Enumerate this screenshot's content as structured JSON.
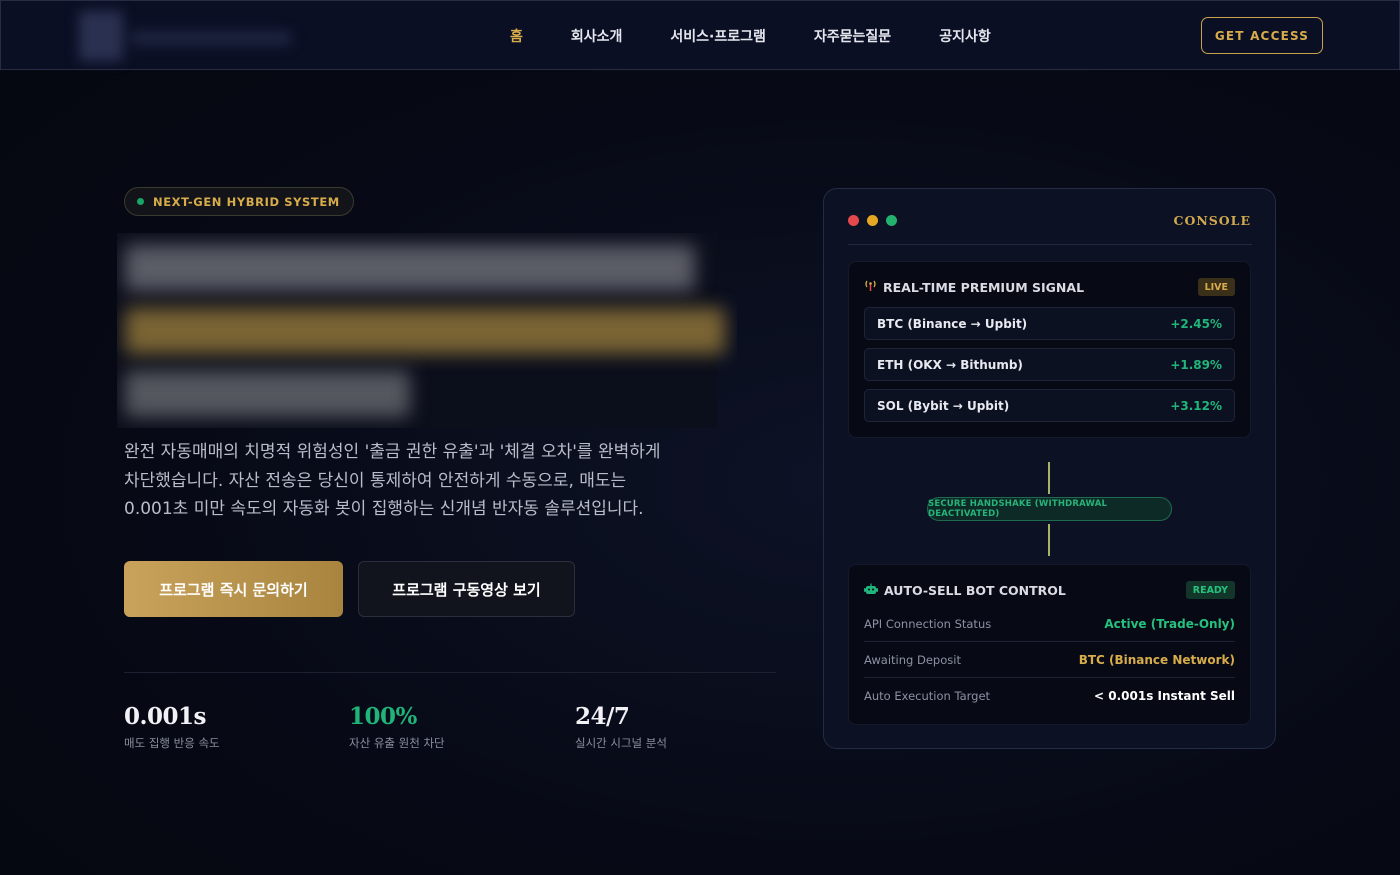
{
  "nav": {
    "items": [
      {
        "label": "홈",
        "active": true
      },
      {
        "label": "회사소개",
        "active": false
      },
      {
        "label": "서비스·프로그램",
        "active": false
      },
      {
        "label": "자주묻는질문",
        "active": false
      },
      {
        "label": "공지사항",
        "active": false
      }
    ],
    "cta_label": "GET ACCESS"
  },
  "hero": {
    "badge": "NEXT-GEN HYBRID SYSTEM",
    "description_lines": [
      "완전 자동매매의 치명적 위험성인 '출금 권한 유출'과 '체결 오차'를 완벽하게",
      "차단했습니다. 자산 전송은 당신이 통제하여 안전하게 수동으로, 매도는",
      "0.001초 미만 속도의 자동화 봇이 집행하는 신개념 반자동 솔루션입니다."
    ],
    "primary_button": "프로그램 즉시 문의하기",
    "secondary_button": "프로그램 구동영상 보기",
    "stats": [
      {
        "value": "0.001s",
        "label": "매도 집행 반응 속도"
      },
      {
        "value": "100%",
        "label": "자산 유출 원천 차단"
      },
      {
        "value": "24/7",
        "label": "실시간 시그널 분석"
      }
    ]
  },
  "console": {
    "title": "CONSOLE",
    "traffic_colors": [
      "#e5484d",
      "#e5a823",
      "#23b26d"
    ],
    "signal_panel": {
      "icon": "broadcast-icon",
      "title": "REAL-TIME PREMIUM SIGNAL",
      "tag": "LIVE",
      "rows": [
        {
          "name": "BTC (Binance → Upbit)",
          "change": "+2.45%"
        },
        {
          "name": "ETH (OKX → Bithumb)",
          "change": "+1.89%"
        },
        {
          "name": "SOL (Bybit → Upbit)",
          "change": "+3.12%"
        }
      ]
    },
    "handshake": "SECURE HANDSHAKE (WITHDRAWAL DEACTIVATED)",
    "bot_panel": {
      "icon": "robot-icon",
      "title": "AUTO-SELL BOT CONTROL",
      "tag": "READY",
      "rows": [
        {
          "key": "API Connection Status",
          "value": "Active (Trade-Only)",
          "color": "green"
        },
        {
          "key": "Awaiting Deposit",
          "value": "BTC (Binance Network)",
          "color": "gold"
        },
        {
          "key": "Auto Execution Target",
          "value": "< 0.001s Instant Sell",
          "color": "white"
        }
      ]
    }
  },
  "colors": {
    "accent_gold": "#d8ac4a",
    "accent_green": "#20b57a",
    "background": "#070a16"
  }
}
